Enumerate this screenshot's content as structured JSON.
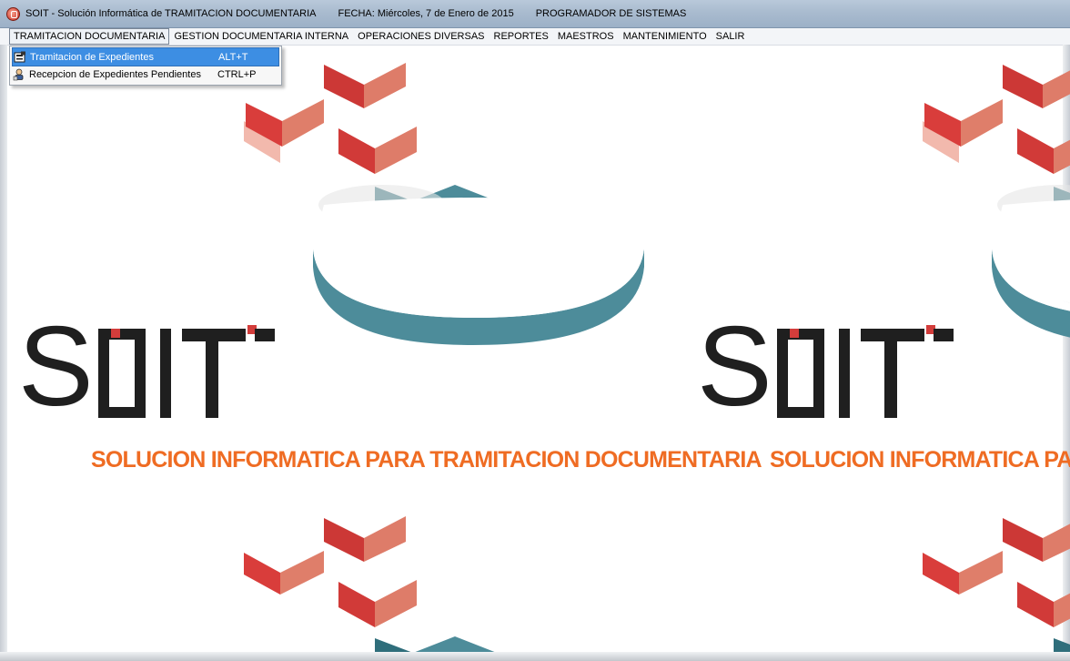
{
  "window": {
    "title": "SOIT - Solución Informática de TRAMITACION DOCUMENTARIA",
    "fecha": "FECHA: Miércoles,  7 de Enero de 2015",
    "user_role": "PROGRAMADOR DE SISTEMAS"
  },
  "menubar": {
    "items": [
      {
        "label": "TRAMITACION DOCUMENTARIA"
      },
      {
        "label": "GESTION DOCUMENTARIA INTERNA"
      },
      {
        "label": "OPERACIONES DIVERSAS"
      },
      {
        "label": "REPORTES"
      },
      {
        "label": "MAESTROS"
      },
      {
        "label": "MANTENIMIENTO"
      },
      {
        "label": "SALIR"
      }
    ]
  },
  "dropdown": {
    "items": [
      {
        "label": "Tramitacion de Expedientes",
        "shortcut": "ALT+T",
        "icon": "document-process-icon"
      },
      {
        "label": "Recepcion de Expedientes Pendientes",
        "shortcut": "CTRL+P",
        "icon": "receive-user-icon"
      }
    ]
  },
  "background": {
    "logo_text": "SOIT",
    "tagline": "SOLUCION INFORMATICA PARA TRAMITACION DOCUMENTARIA",
    "colors": {
      "accent_orange": "#ef6c23",
      "logo_dark": "#1f1f1f",
      "teal": "#4d8c9a",
      "red": "#cc3d3a"
    }
  }
}
